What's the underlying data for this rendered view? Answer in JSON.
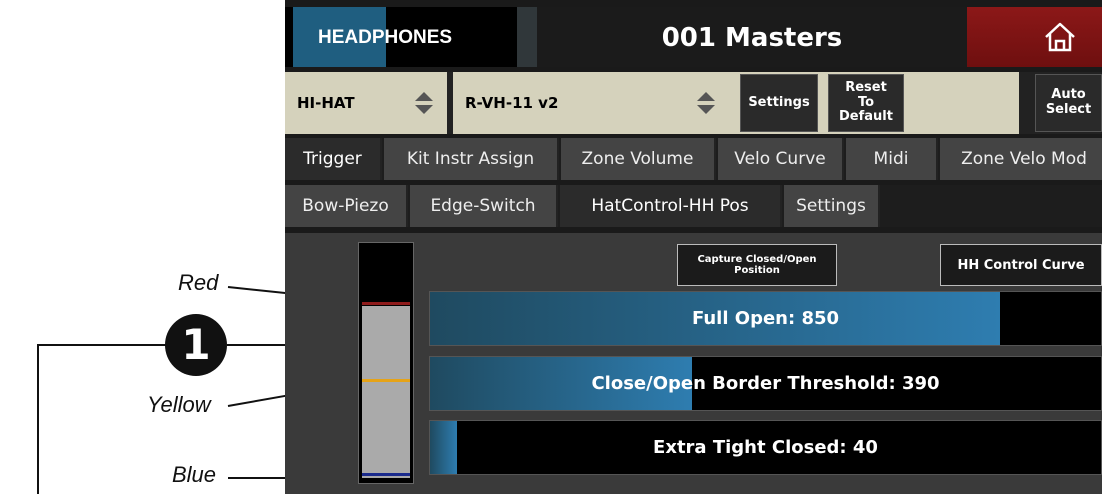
{
  "annotations": {
    "red_label": "Red",
    "yellow_label": "Yellow",
    "blue_label": "Blue",
    "callout_number": "1"
  },
  "header": {
    "output_label": "HEADPHONES",
    "kit_title": "001 Masters",
    "home_icon": "home-icon"
  },
  "controls": {
    "pad_select": "HI-HAT",
    "instrument_select": "R-VH-11 v2",
    "settings_button": "Settings",
    "reset_button": "Reset\nTo\nDefault",
    "auto_select_button": "Auto\nSelect"
  },
  "tabs_row1": [
    {
      "label": "Trigger",
      "active": true
    },
    {
      "label": "Kit Instr Assign",
      "active": false
    },
    {
      "label": "Zone Volume",
      "active": false
    },
    {
      "label": "Velo Curve",
      "active": false
    },
    {
      "label": "Midi",
      "active": false
    },
    {
      "label": "Zone Velo Mod",
      "active": false
    }
  ],
  "tabs_row2": [
    {
      "label": "Bow-Piezo",
      "active": false
    },
    {
      "label": "Edge-Switch",
      "active": false
    },
    {
      "label": "HatControl-HH Pos",
      "active": true
    },
    {
      "label": "Settings",
      "active": false
    }
  ],
  "panel": {
    "capture_button": "Capture Closed/Open\nPosition",
    "curve_button": "HH Control Curve"
  },
  "meter": {
    "colors": {
      "red": "#8e1b1b",
      "yellow": "#e6a317",
      "blue": "#1a2a8c"
    }
  },
  "bars": [
    {
      "label": "Full Open: 850",
      "fill": 0.85
    },
    {
      "label": "Close/Open Border Threshold: 390",
      "fill": 0.39
    },
    {
      "label": "Extra Tight Closed: 40",
      "fill": 0.04
    }
  ],
  "colors": {
    "accent_blue": "#2e7db0",
    "home_red": "#8c1818",
    "select_bg": "#d5d2bc"
  }
}
